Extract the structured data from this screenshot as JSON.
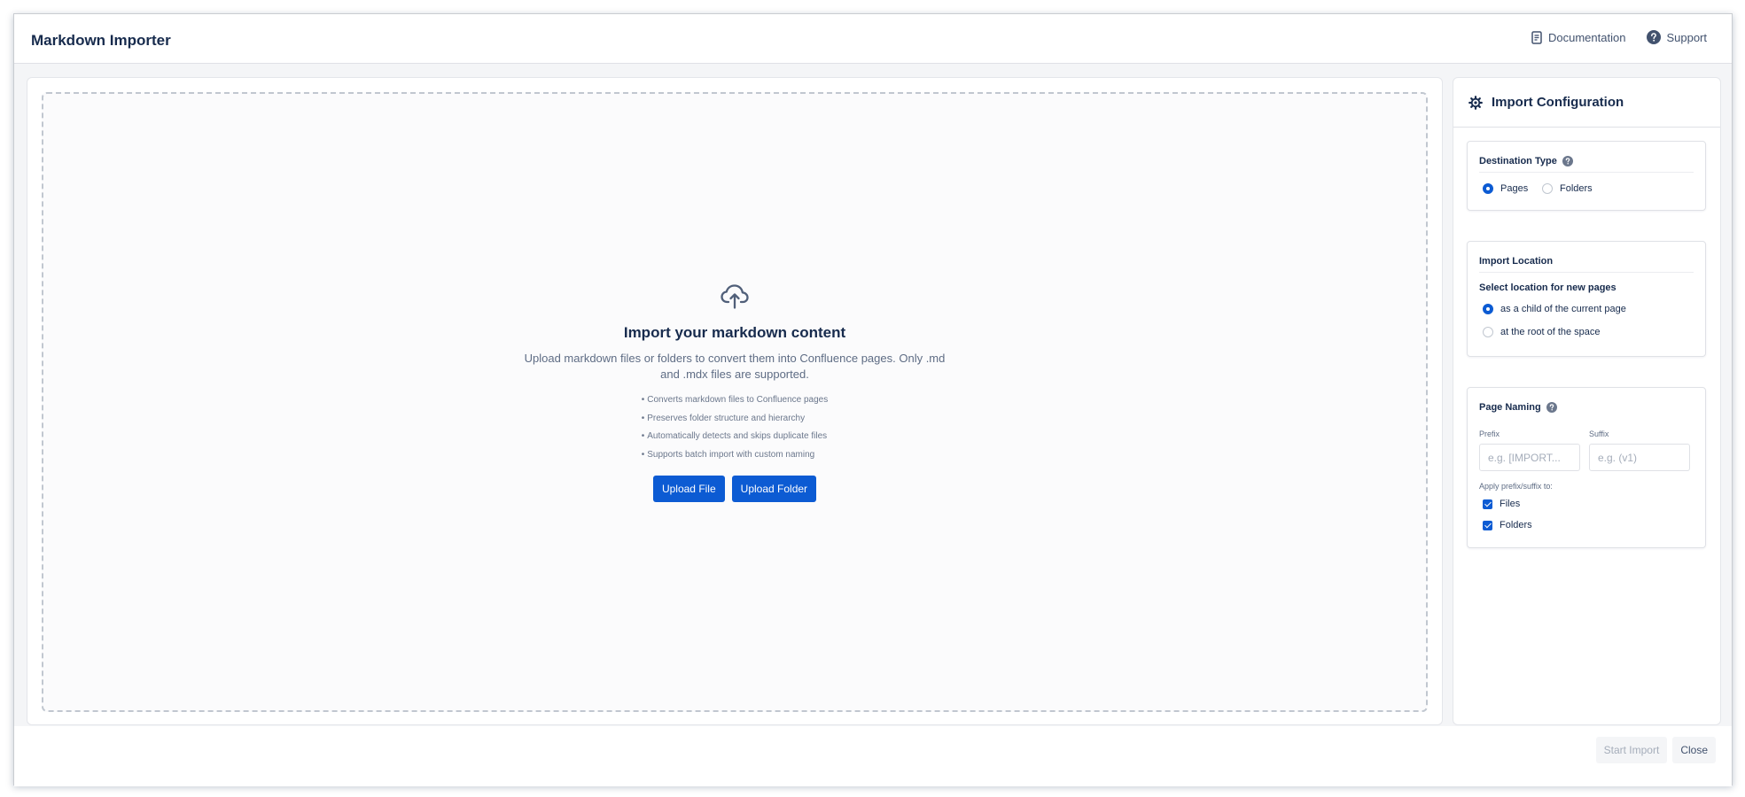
{
  "header": {
    "title": "Markdown Importer",
    "links": {
      "documentation": "Documentation",
      "support": "Support"
    }
  },
  "dropzone": {
    "title": "Import your markdown content",
    "description": "Upload markdown files or folders to convert them into Confluence pages. Only .md and .mdx files are supported.",
    "features": [
      "Converts markdown files to Confluence pages",
      "Preserves folder structure and hierarchy",
      "Automatically detects and skips duplicate files",
      "Supports batch import with custom naming"
    ],
    "bullet": "•",
    "buttons": {
      "upload_file": "Upload File",
      "upload_folder": "Upload Folder"
    }
  },
  "config": {
    "title": "Import Configuration",
    "destination": {
      "title": "Destination Type",
      "options": [
        "Pages",
        "Folders"
      ],
      "selected": "Pages"
    },
    "location": {
      "title": "Import Location",
      "subtitle": "Select location for new pages",
      "options": [
        "as a child of the current page",
        "at the root of the space"
      ],
      "selected": "as a child of the current page"
    },
    "naming": {
      "title": "Page Naming",
      "prefix_label": "Prefix",
      "prefix_placeholder": "e.g. [IMPORT...",
      "prefix_value": "",
      "suffix_label": "Suffix",
      "suffix_placeholder": "e.g. (v1)",
      "suffix_value": "",
      "apply_label": "Apply prefix/suffix to:",
      "apply_options": [
        "Files",
        "Folders"
      ],
      "apply_checked": [
        true,
        true
      ]
    }
  },
  "footer": {
    "start_import": "Start Import",
    "close": "Close"
  },
  "colors": {
    "primary": "#0c5bd3",
    "text": "#172b4d",
    "muted": "#5e6c84",
    "disabled": "#a5adba",
    "background": "#f4f5f7"
  },
  "icons": {
    "documentation": "document-icon",
    "support": "question-circle-icon",
    "upload": "cloud-upload-icon",
    "config": "gear-icon",
    "help": "help-icon"
  }
}
